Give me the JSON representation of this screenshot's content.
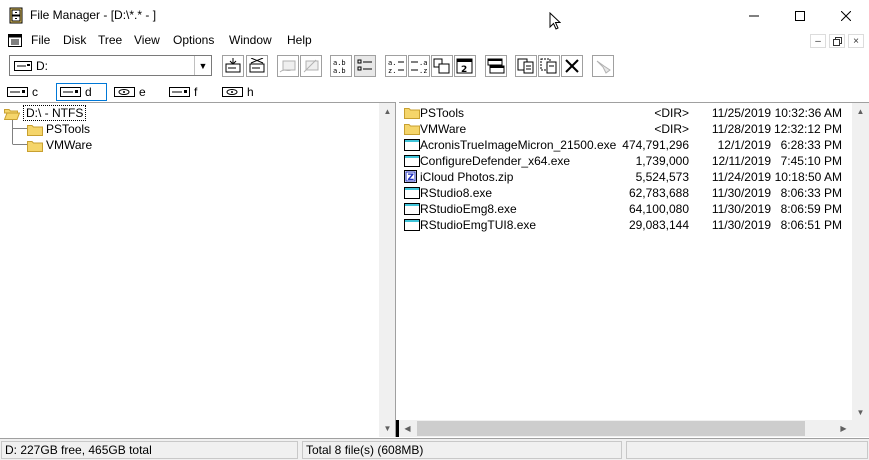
{
  "window": {
    "title": "File Manager - [D:\\*.* - ]"
  },
  "menu": {
    "items": [
      {
        "label": "File"
      },
      {
        "label": "Disk"
      },
      {
        "label": "Tree"
      },
      {
        "label": "View"
      },
      {
        "label": "Options"
      },
      {
        "label": "Window"
      },
      {
        "label": "Help"
      }
    ]
  },
  "toolbar": {
    "drive_value": "D:",
    "buttons": [
      "connect-network-icon",
      "disconnect-network-icon",
      "share-icon",
      "stop-sharing-icon",
      "view-name-icon",
      "view-details-icon",
      "sort-name-icon",
      "sort-type-icon",
      "sort-size-icon",
      "sort-date-icon",
      "new-window-icon",
      "copy-icon",
      "move-icon",
      "delete-icon",
      "properties-icon"
    ]
  },
  "drives": [
    {
      "letter": "c"
    },
    {
      "letter": "d"
    },
    {
      "letter": "e"
    },
    {
      "letter": "f"
    },
    {
      "letter": "h"
    }
  ],
  "tree": {
    "root": "D:\\ - NTFS",
    "children": [
      "PSTools",
      "VMWare"
    ]
  },
  "files": [
    {
      "name": "PSTools",
      "size": "<DIR>",
      "date": "11/25/2019",
      "time": "10:32:36 AM",
      "type": "folder"
    },
    {
      "name": "VMWare",
      "size": "<DIR>",
      "date": "11/28/2019",
      "time": "12:32:12 PM",
      "type": "folder"
    },
    {
      "name": "AcronisTrueImageMicron_21500.exe",
      "size": "474,791,296",
      "date": "12/1/2019",
      "time": "6:28:33 PM",
      "type": "exe"
    },
    {
      "name": "ConfigureDefender_x64.exe",
      "size": "1,739,000",
      "date": "12/11/2019",
      "time": "7:45:10 PM",
      "type": "exe"
    },
    {
      "name": "iCloud Photos.zip",
      "size": "5,524,573",
      "date": "11/24/2019",
      "time": "10:18:50 AM",
      "type": "zip"
    },
    {
      "name": "RStudio8.exe",
      "size": "62,783,688",
      "date": "11/30/2019",
      "time": "8:06:33 PM",
      "type": "exe"
    },
    {
      "name": "RStudioEmg8.exe",
      "size": "64,100,080",
      "date": "11/30/2019",
      "time": "8:06:59 PM",
      "type": "exe"
    },
    {
      "name": "RStudioEmgTUI8.exe",
      "size": "29,083,144",
      "date": "11/30/2019",
      "time": "8:06:51 PM",
      "type": "exe"
    }
  ],
  "status": {
    "free": "D: 227GB free,  465GB total",
    "total": "Total 8 file(s) (608MB)"
  },
  "colors": {
    "folder": "#f5d56a",
    "folder_edge": "#c8a030",
    "exe_title": "#3ec3d8",
    "accent": "#0078d7"
  }
}
